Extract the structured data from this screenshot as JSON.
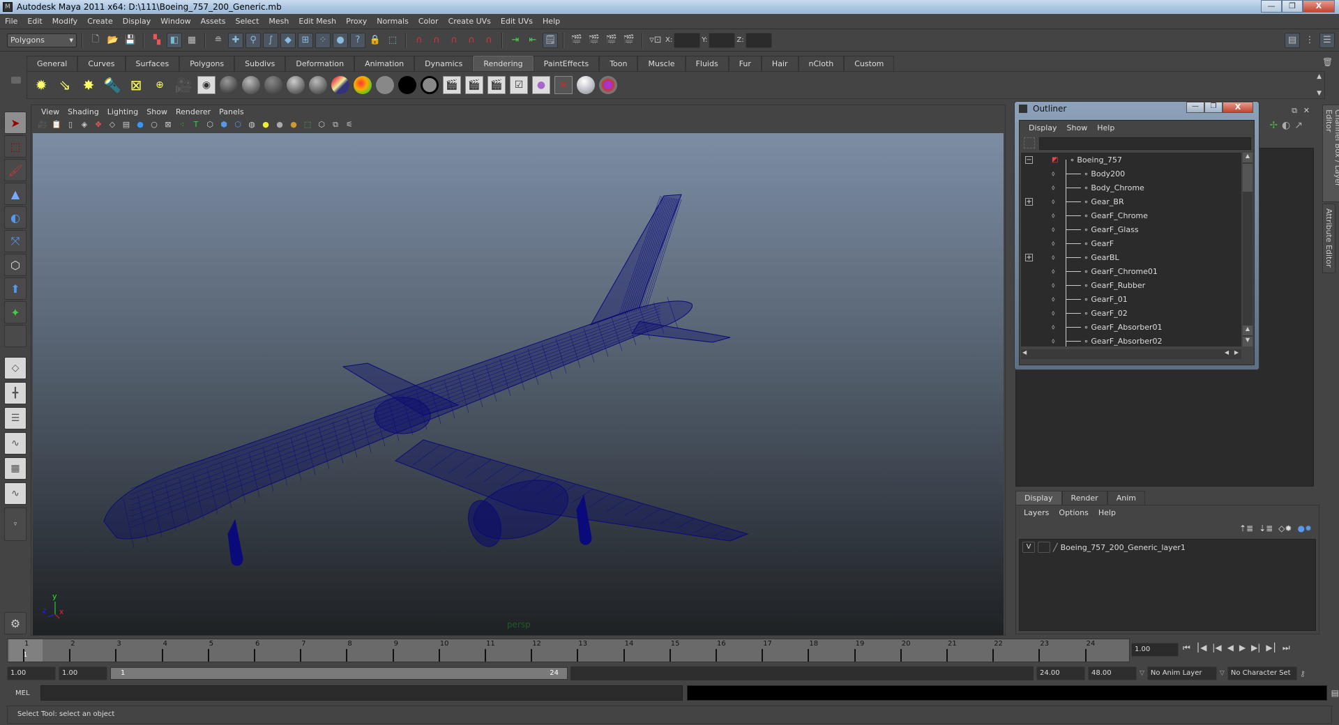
{
  "window": {
    "title": "Autodesk Maya 2011 x64: D:\\111\\Boeing_757_200_Generic.mb",
    "minimize": "—",
    "restore": "❐",
    "close": "X"
  },
  "menubar": [
    "File",
    "Edit",
    "Modify",
    "Create",
    "Display",
    "Window",
    "Assets",
    "Select",
    "Mesh",
    "Edit Mesh",
    "Proxy",
    "Normals",
    "Color",
    "Create UVs",
    "Edit UVs",
    "Help"
  ],
  "statusline": {
    "menuset": "Polygons",
    "xyz_labels": {
      "x": "X:",
      "y": "Y:",
      "z": "Z:"
    },
    "xyz_values": {
      "x": "",
      "y": "",
      "z": ""
    }
  },
  "shelf": {
    "tabs": [
      "General",
      "Curves",
      "Surfaces",
      "Polygons",
      "Subdivs",
      "Deformation",
      "Animation",
      "Dynamics",
      "Rendering",
      "PaintEffects",
      "Toon",
      "Muscle",
      "Fluids",
      "Fur",
      "Hair",
      "nCloth",
      "Custom"
    ],
    "active_tab": "Rendering",
    "icons": [
      "ambient-light-icon",
      "directional-light-icon",
      "point-light-icon",
      "spot-light-icon",
      "area-light-icon",
      "volume-light-icon",
      "camera-icon",
      "render-view-icon",
      "anisotropic-shader-icon",
      "blinn-shader-icon",
      "lambert-shader-icon",
      "phong-shader-icon",
      "phonge-shader-icon",
      "layered-shader-icon",
      "ramp-shader-icon",
      "surface-shader-icon",
      "use-background-icon",
      "shading-map-icon",
      "render-frame-icon",
      "ipr-render-icon",
      "batch-render-icon",
      "render-settings-icon",
      "hypershade-icon",
      "remove-material-icon",
      "assign-material-icon",
      "paint-shader-icon"
    ]
  },
  "viewport": {
    "menu": [
      "View",
      "Shading",
      "Lighting",
      "Show",
      "Renderer",
      "Panels"
    ],
    "camera_label": "persp",
    "axis_labels": {
      "x": "x",
      "y": "y",
      "z": "z"
    },
    "wire_color": "#0a0a7a"
  },
  "outliner": {
    "title": "Outliner",
    "menu": [
      "Display",
      "Show",
      "Help"
    ],
    "filter_value": "",
    "items": [
      {
        "name": "Boeing_757",
        "expand": "−",
        "root": true
      },
      {
        "name": "Body200",
        "expand": ""
      },
      {
        "name": "Body_Chrome",
        "expand": ""
      },
      {
        "name": "Gear_BR",
        "expand": "+"
      },
      {
        "name": "GearF_Chrome",
        "expand": ""
      },
      {
        "name": "GearF_Glass",
        "expand": ""
      },
      {
        "name": "GearF",
        "expand": ""
      },
      {
        "name": "GearBL",
        "expand": "+"
      },
      {
        "name": "GearF_Chrome01",
        "expand": ""
      },
      {
        "name": "GearF_Rubber",
        "expand": ""
      },
      {
        "name": "GearF_01",
        "expand": ""
      },
      {
        "name": "GearF_02",
        "expand": ""
      },
      {
        "name": "GearF_Absorber01",
        "expand": ""
      },
      {
        "name": "GearF_Absorber02",
        "expand": ""
      }
    ]
  },
  "side_tabs": [
    "Channel Box / Layer Editor",
    "Attribute Editor"
  ],
  "layer_editor": {
    "tabs": [
      "Display",
      "Render",
      "Anim"
    ],
    "active_tab": "Display",
    "menu": [
      "Layers",
      "Options",
      "Help"
    ],
    "layers": [
      {
        "visible": "V",
        "type": "",
        "name": "Boeing_757_200_Generic_layer1"
      }
    ]
  },
  "timeline": {
    "ticks": [
      "1",
      "2",
      "3",
      "4",
      "5",
      "6",
      "7",
      "8",
      "9",
      "10",
      "11",
      "12",
      "13",
      "14",
      "15",
      "16",
      "17",
      "18",
      "19",
      "20",
      "21",
      "22",
      "23",
      "24"
    ],
    "current_frame": "1",
    "current_time": "1.00",
    "playback_buttons": [
      "go-to-start",
      "step-back-key",
      "step-back-frame",
      "play-backward",
      "play-forward",
      "step-forward-frame",
      "step-forward-key",
      "go-to-end"
    ]
  },
  "range": {
    "start_time": "1.00",
    "playback_start": "1.00",
    "range_start": "1",
    "range_end": "24",
    "playback_end": "24.00",
    "end_time": "48.00",
    "anim_layer": "No Anim Layer",
    "character_set": "No Character Set"
  },
  "command_line": {
    "label": "MEL",
    "input": "",
    "output": ""
  },
  "help_line": "Select Tool: select an object"
}
